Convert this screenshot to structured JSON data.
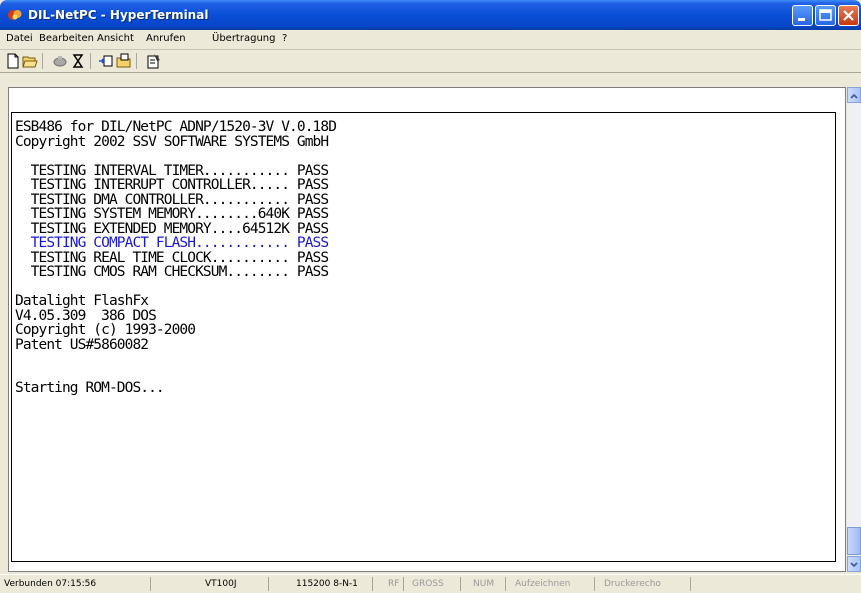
{
  "window": {
    "title": "DIL-NetPC - HyperTerminal"
  },
  "menu": [
    "Datei",
    "Bearbeiten",
    "Ansicht",
    "Anrufen",
    "Übertragung",
    "?"
  ],
  "toolbar": {
    "icons": [
      "new-icon",
      "open-icon",
      "disconnect-icon",
      "connect-icon",
      "send-icon",
      "receive-icon",
      "properties-icon"
    ]
  },
  "terminal": {
    "lines": [
      "ESB486 for DIL/NetPC ADNP/1520-3V V.0.18D",
      "Copyright 2002 SSV SOFTWARE SYSTEMS GmbH",
      "",
      "  TESTING INTERVAL TIMER........... PASS",
      "  TESTING INTERRUPT CONTROLLER..... PASS",
      "  TESTING DMA CONTROLLER........... PASS",
      "  TESTING SYSTEM MEMORY........640K PASS",
      "  TESTING EXTENDED MEMORY....64512K PASS",
      "  TESTING COMPACT FLASH............ PASS",
      "  TESTING REAL TIME CLOCK.......... PASS",
      "  TESTING CMOS RAM CHECKSUM........ PASS",
      "",
      "Datalight FlashFx",
      "V4.05.309  386 DOS",
      "Copyright (c) 1993-2000",
      "Patent US#5860082",
      "",
      "",
      "Starting ROM-DOS..."
    ],
    "highlight_index": 8,
    "highlight_color": "#1818d8"
  },
  "status": {
    "connected": "Verbunden 07:15:56",
    "emulation": "VT100J",
    "settings": "115200 8-N-1",
    "rf": "RF",
    "gross": "GROSS",
    "num": "NUM",
    "record": "Aufzeichnen",
    "printecho": "Druckerecho"
  },
  "colors": {
    "titlebar": "#0a4fd8",
    "chrome": "#ece9d8"
  }
}
